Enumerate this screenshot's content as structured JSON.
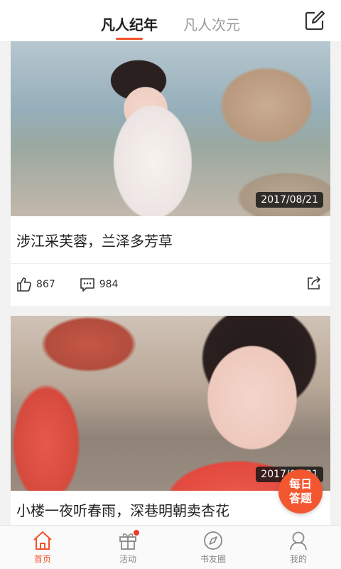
{
  "colors": {
    "accent": "#f0542a",
    "badge_bg": "#141414",
    "bg": "#f2f2f2"
  },
  "header": {
    "tabs": [
      {
        "label": "凡人纪年",
        "active": true
      },
      {
        "label": "凡人次元",
        "active": false
      }
    ],
    "edit_icon": "edit-square-icon"
  },
  "feed": [
    {
      "date": "2017/08/21",
      "title": "涉江采芙蓉，兰泽多芳草",
      "likes": "867",
      "comments": "984"
    },
    {
      "date": "2017/08/21",
      "title": "小楼一夜听春雨，深巷明朝卖杏花"
    }
  ],
  "floating": {
    "line1": "每日",
    "line2": "答题"
  },
  "bottom_nav": [
    {
      "label": "首页",
      "icon": "home-icon",
      "active": true
    },
    {
      "label": "活动",
      "icon": "gift-icon",
      "badge": true
    },
    {
      "label": "书友圈",
      "icon": "compass-icon"
    },
    {
      "label": "我的",
      "icon": "user-icon"
    }
  ]
}
